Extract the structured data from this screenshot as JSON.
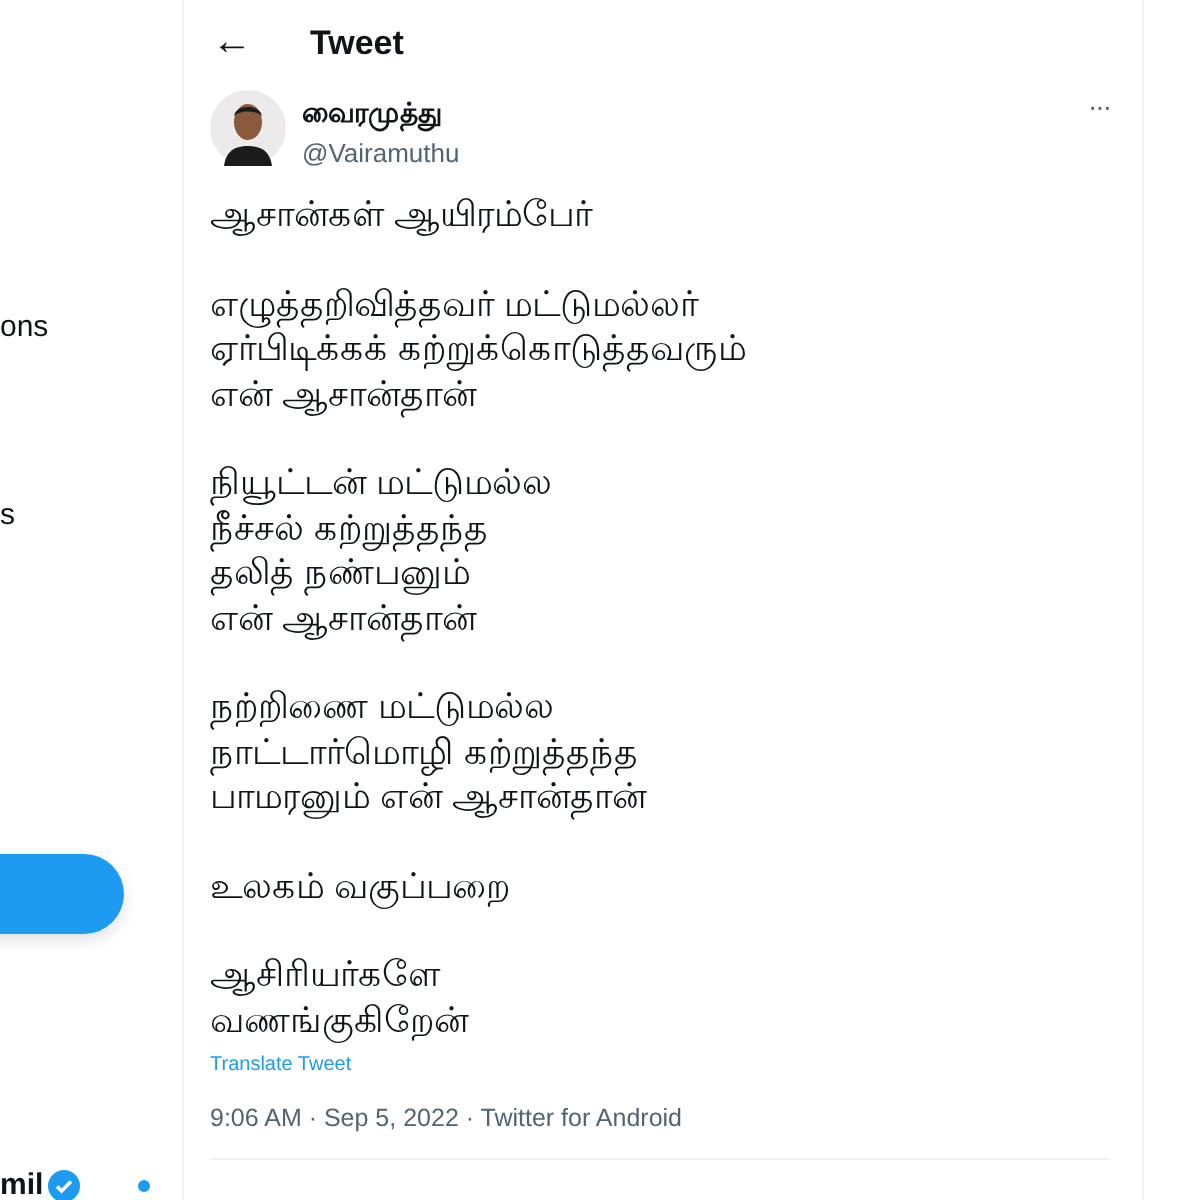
{
  "sidebar": {
    "items": [
      {
        "label": "ons"
      },
      {
        "label": "s"
      }
    ],
    "account": {
      "name": "mil",
      "verified": true,
      "unread": true
    }
  },
  "header": {
    "back": "←",
    "title": "Tweet"
  },
  "tweet": {
    "author": {
      "name": "வைரமுத்து",
      "handle": "@Vairamuthu"
    },
    "more": "···",
    "stanzas": [
      [
        "ஆசான்கள் ஆயிரம்பேர்"
      ],
      [
        "எழுத்தறிவித்தவர் மட்டுமல்லர்",
        "ஏர்பிடிக்கக் கற்றுக்கொடுத்தவரும்",
        "என் ஆசான்தான்"
      ],
      [
        "நியூட்டன் மட்டுமல்ல",
        "நீச்சல் கற்றுத்தந்த",
        "தலித் நண்பனும்",
        "என் ஆசான்தான்"
      ],
      [
        "நற்றிணை மட்டுமல்ல",
        "நாட்டார்மொழி கற்றுத்தந்த",
        "பாமரனும் என் ஆசான்தான்"
      ],
      [
        "உலகம் வகுப்பறை"
      ],
      [
        "ஆசிரியர்களே",
        "வணங்குகிறேன்"
      ]
    ],
    "translate": "Translate Tweet",
    "meta": "9:06 AM · Sep 5, 2022 · Twitter for Android"
  }
}
